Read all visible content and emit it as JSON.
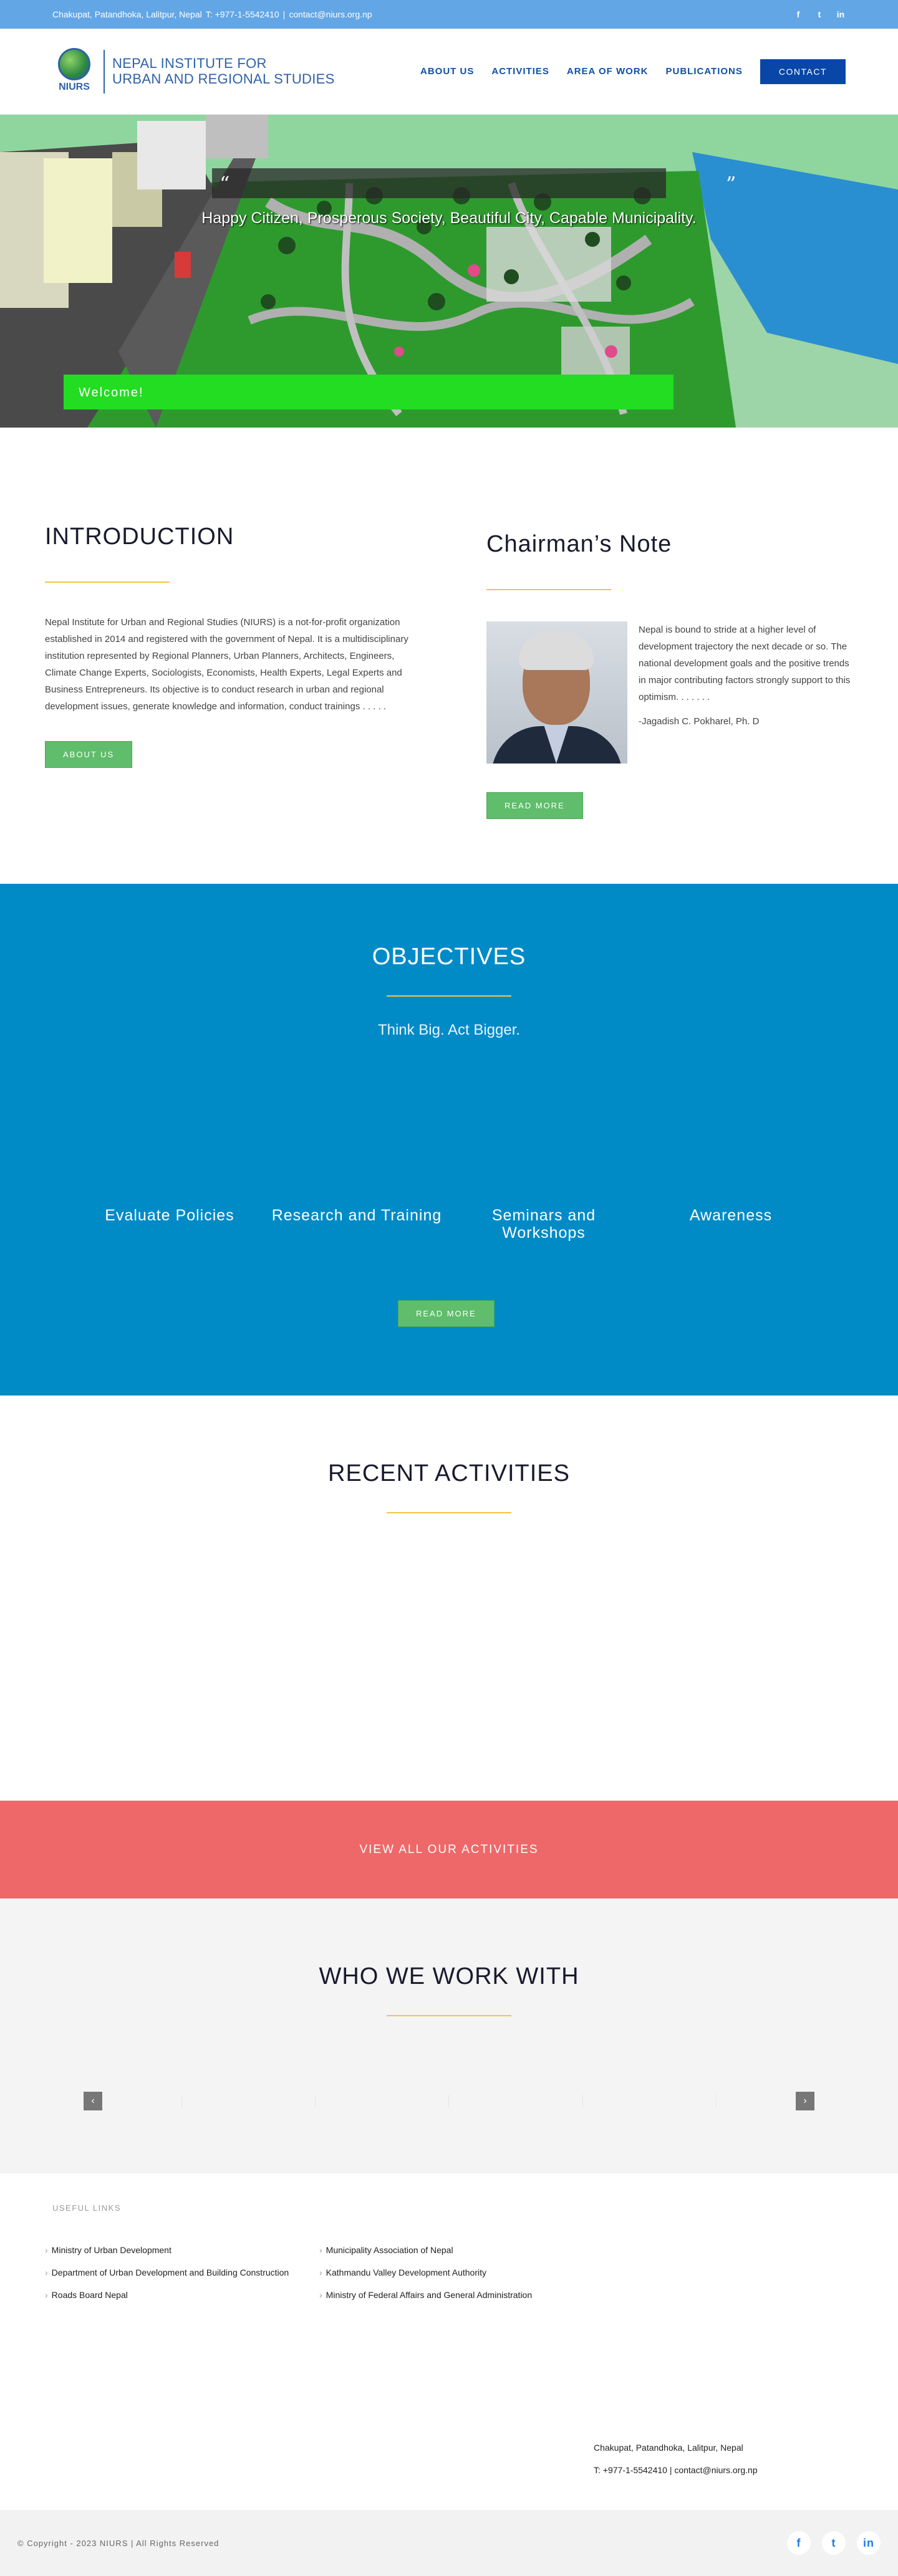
{
  "topbar": {
    "address": "Chakupat, Patandhoka, Lalitpur, Nepal",
    "phone": "T: +977-1-5542410",
    "separator": "|",
    "email": "contact@niurs.org.np",
    "social": [
      "f",
      "t",
      "in"
    ]
  },
  "logo": {
    "abbr": "NIURS",
    "line1": "NEPAL INSTITUTE FOR",
    "line2": "URBAN AND REGIONAL STUDIES"
  },
  "nav": {
    "items": [
      "ABOUT US",
      "ACTIVITIES",
      "AREA OF WORK",
      "PUBLICATIONS"
    ],
    "contact": "CONTACT"
  },
  "hero": {
    "quote_open": "“",
    "quote_close": "”",
    "tagline": "Happy Citizen, Prosperous Society, Beautiful City, Capable Municipality.",
    "welcome": "Welcome!"
  },
  "intro": {
    "title": "INTRODUCTION",
    "body": "Nepal Institute for Urban and Regional Studies (NIURS) is a not-for-profit organization established in 2014 and registered with the government of Nepal. It is a multidisciplinary institution represented by Regional Planners, Urban Planners, Architects, Engineers, Climate Change Experts, Sociologists, Economists, Health Experts, Legal Experts and Business Entrepreneurs. Its objective is to conduct research in urban and regional development issues, generate knowledge and information, conduct trainings . . . . .",
    "button": "ABOUT US"
  },
  "chairman": {
    "title": "Chairman’s Note",
    "body": "Nepal is bound to stride at a higher level of development trajectory the next decade or so. The national development goals and the positive trends in major contributing factors strongly support to this optimism. . . . . . .",
    "signature": "-Jagadish C. Pokharel, Ph. D",
    "button": "READ MORE"
  },
  "objectives": {
    "title": "OBJECTIVES",
    "subtitle": "Think Big. Act Bigger.",
    "items": [
      "Evaluate Policies",
      "Research and Training",
      "Seminars and Workshops",
      "Awareness"
    ],
    "button": "READ MORE"
  },
  "recent": {
    "title": "RECENT ACTIVITIES"
  },
  "banner": {
    "label": "VIEW ALL OUR ACTIVITIES"
  },
  "partners": {
    "title": "WHO WE WORK WITH",
    "prev": "‹",
    "next": "›"
  },
  "footer": {
    "heading": "USEFUL LINKS",
    "links_col1": [
      "Ministry of Urban Development",
      "Department of Urban Development and Building Construction",
      "Roads Board Nepal"
    ],
    "links_col2": [
      "Municipality Association of Nepal",
      "Kathmandu Valley Development Authority",
      "Ministry of Federal Affairs and General Administration"
    ],
    "address": "Chakupat, Patandhoka, Lalitpur, Nepal",
    "contact_line": "T: +977-1-5542410 | contact@niurs.org.np"
  },
  "copyright": {
    "text": "© Copyright - 2023 NIURS   |   All Rights Reserved",
    "social": [
      "f",
      "t",
      "in"
    ]
  },
  "colors": {
    "topbar": "#62a6e6",
    "nav": "#124fa8",
    "contact_button": "#0847a8",
    "accent_underline": "#f4c542",
    "green_button": "#5fbd6b",
    "objectives_bg": "#008bc7",
    "banner_bg": "#ef6869"
  }
}
